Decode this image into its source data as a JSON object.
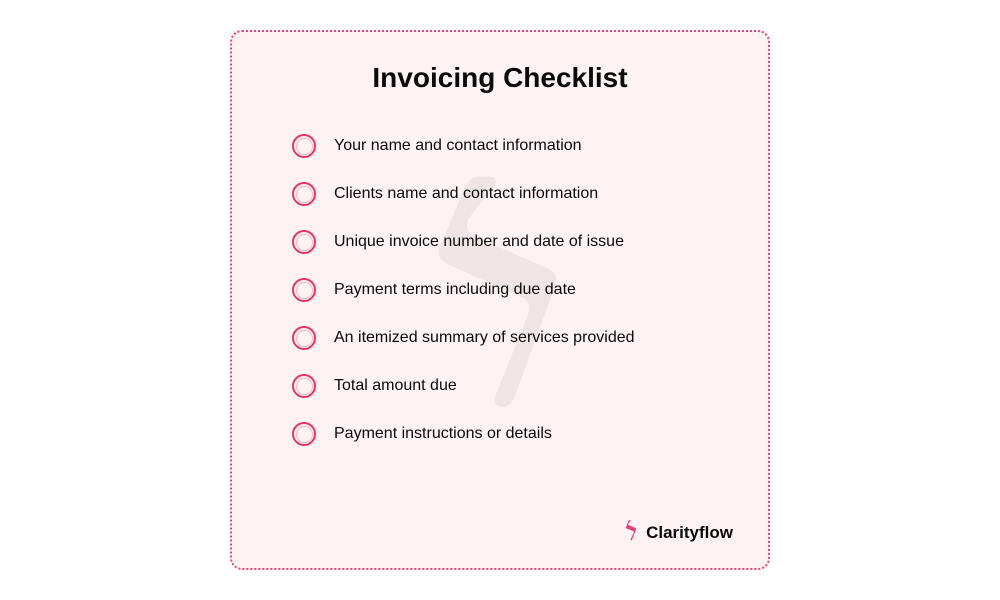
{
  "title": "Invoicing Checklist",
  "items": [
    "Your name and contact information",
    "Clients name and contact information",
    "Unique invoice number and date of issue",
    "Payment terms including due date",
    "An itemized summary of services provided",
    "Total amount due",
    "Payment instructions or details"
  ],
  "brand": {
    "name": "Clarityflow"
  }
}
